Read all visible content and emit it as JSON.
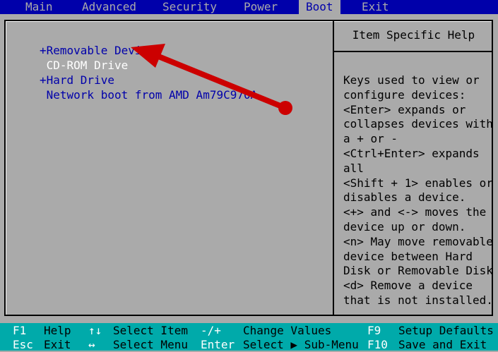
{
  "menu": {
    "tabs": [
      {
        "label": "Main"
      },
      {
        "label": "Advanced"
      },
      {
        "label": "Security"
      },
      {
        "label": "Power"
      },
      {
        "label": "Boot"
      },
      {
        "label": "Exit"
      }
    ],
    "active": "Boot"
  },
  "boot_list": {
    "items": [
      {
        "label": "+Removable Devices"
      },
      {
        "label": " CD-ROM Drive"
      },
      {
        "label": "+Hard Drive"
      },
      {
        "label": " Network boot from AMD Am79C970A"
      }
    ],
    "selected_index": 1
  },
  "help": {
    "title": "Item Specific Help",
    "lines": [
      "Keys used to view or",
      "configure devices:",
      "<Enter> expands or",
      "collapses devices with",
      "a + or -",
      "<Ctrl+Enter> expands",
      "all",
      "<Shift + 1> enables or",
      "disables a device.",
      "<+> and <-> moves the",
      "device up or down.",
      "<n> May move removable",
      "device between Hard",
      "Disk or Removable Disk",
      "<d> Remove a device",
      "that is not installed."
    ]
  },
  "footer": {
    "row1": [
      {
        "key": "F1",
        "label": "Help"
      },
      {
        "key": "↑↓",
        "label": "Select Item"
      },
      {
        "key": "-/+",
        "label": "Change Values"
      },
      {
        "key": "F9",
        "label": "Setup Defaults"
      }
    ],
    "row2": [
      {
        "key": "Esc",
        "label": "Exit"
      },
      {
        "key": "↔",
        "label": "Select Menu"
      },
      {
        "key": "Enter",
        "label": "Select ▶ Sub-Menu"
      },
      {
        "key": "F10",
        "label": "Save and Exit"
      }
    ]
  },
  "colors": {
    "menubar": "#0000aa",
    "panel": "#aaaaaa",
    "footer": "#00aaaa",
    "arrow": "#cc0000",
    "highlight": "#ffffff",
    "item": "#0000aa"
  }
}
